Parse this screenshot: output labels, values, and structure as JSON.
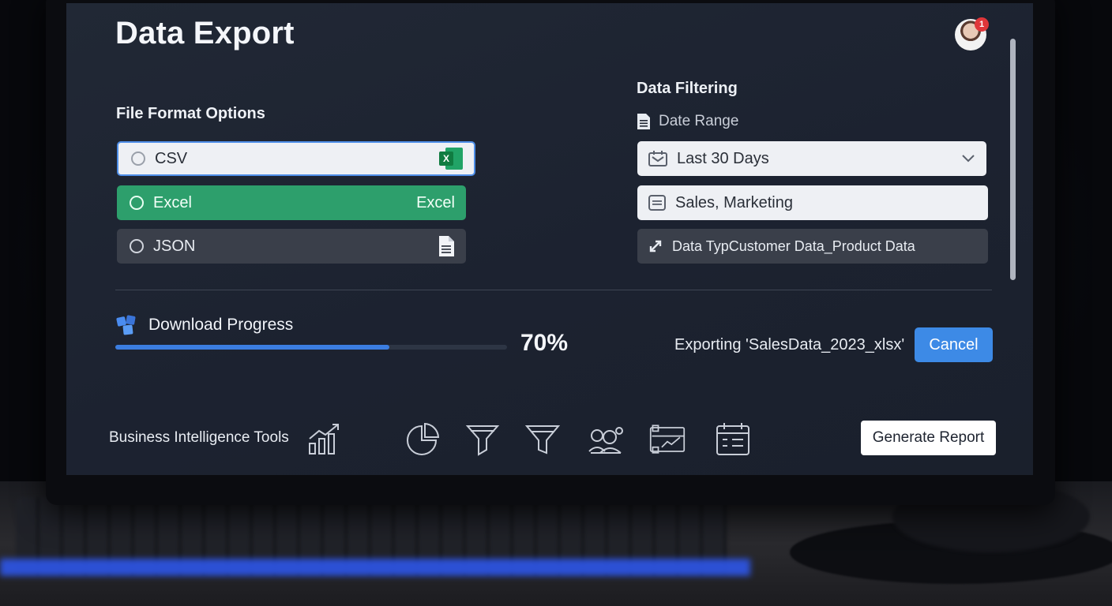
{
  "header": {
    "title": "Data Export",
    "notification_count": "1"
  },
  "file_format": {
    "section_label": "File Format Options",
    "options": [
      {
        "label": "CSV",
        "icon": "excel-icon"
      },
      {
        "label": "Excel",
        "badge": "Excel"
      },
      {
        "label": "JSON",
        "icon": "document-icon"
      }
    ]
  },
  "filtering": {
    "section_label": "Data Filtering",
    "date_range_label": "Date Range",
    "date_range_value": "Last 30 Days",
    "categories_value": "Sales, Marketing",
    "data_type_value": "Data TypCustomer Data_Product Data"
  },
  "progress": {
    "title": "Download Progress",
    "percent": 70,
    "percent_label": "70%",
    "status_text": "Exporting 'SalesData_2023_xlsx'",
    "cancel_label": "Cancel"
  },
  "bi_tools": {
    "label": "Business Intelligence Tools",
    "tools": [
      "line-chart-icon",
      "pie-chart-icon",
      "filter-icon",
      "funnel-icon",
      "users-icon",
      "dashboard-icon",
      "calendar-icon"
    ],
    "generate_label": "Generate Report"
  },
  "colors": {
    "accent": "#3d8ae6",
    "excel_green": "#2d9f6c",
    "background": "#1f2633"
  }
}
